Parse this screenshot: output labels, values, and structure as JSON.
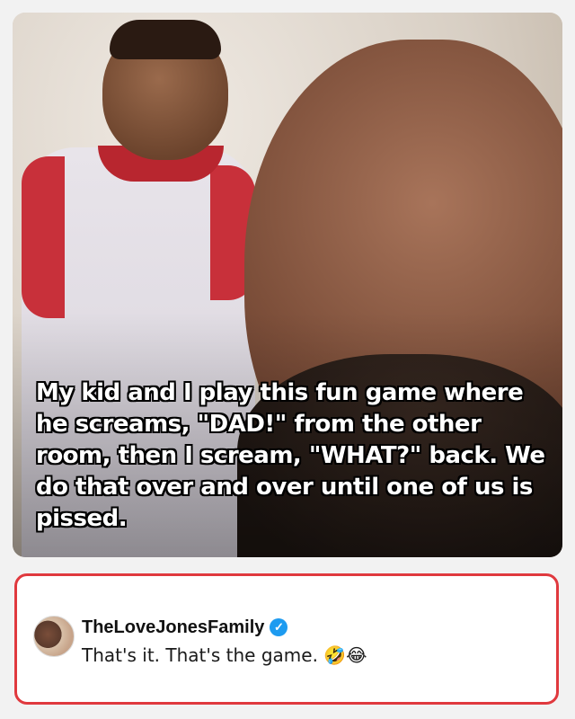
{
  "post": {
    "caption": "My kid and I play this fun game where he screams, \"DAD!\" from the other room, then I scream, \"WHAT?\" back. We do that over and over until one of us is pissed."
  },
  "comment": {
    "username": "TheLoveJonesFamily",
    "verified_icon": "verified-badge-icon",
    "text": "That's it. That's the game. 🤣😂",
    "accent_color": "#e0393e"
  }
}
